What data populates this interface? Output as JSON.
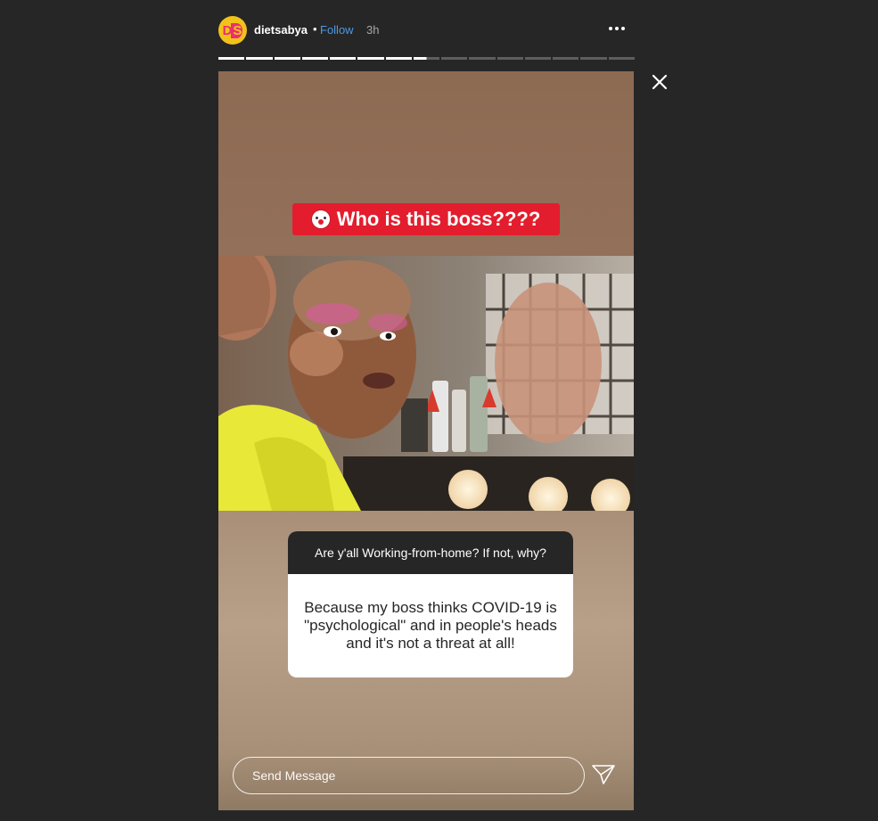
{
  "header": {
    "avatar_text_left": "D",
    "avatar_text_right": "S",
    "username": "dietsabya",
    "separator": "•",
    "follow_label": "Follow",
    "time": "3h"
  },
  "progress": {
    "total_segments": 15,
    "completed_segments": 7,
    "current_fraction": 0.5
  },
  "story": {
    "title_sticker": "Who is this boss????",
    "question": "Are y'all Working-from-home? If not, why?",
    "answer": "Because my boss thinks COVID-19 is \"psychological\" and in people's heads and it's not a threat at all!"
  },
  "reply": {
    "placeholder": "Send Message"
  },
  "colors": {
    "background": "#262626",
    "follow": "#4a9ae6",
    "sticker_red": "#e31d2d",
    "avatar_yellow": "#f2c21b",
    "avatar_pink": "#e8306f"
  },
  "icons": {
    "more": "more-horizontal-icon",
    "close": "close-icon",
    "send": "paper-plane-icon",
    "clown": "clown-emoji-icon"
  }
}
